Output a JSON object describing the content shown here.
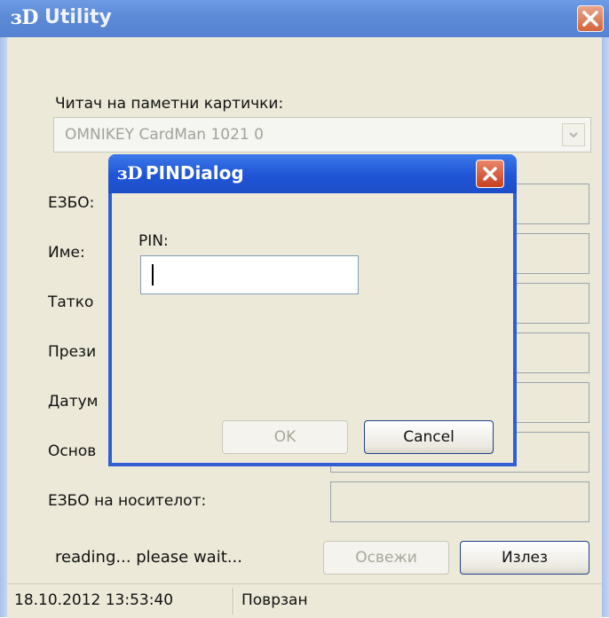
{
  "main_window": {
    "title": "Utility",
    "logo_text": "ɜD",
    "reader_label": "Читач на паметни картички:",
    "reader_value": "OMNIKEY CardMan 1021 0",
    "fields": [
      {
        "label": "ЕЗБО:"
      },
      {
        "label": "Име:"
      },
      {
        "label": "Татко"
      },
      {
        "label": "Прези"
      },
      {
        "label": "Датум"
      },
      {
        "label": "Основ"
      },
      {
        "label": "ЕЗБО на носителот:"
      }
    ],
    "status_message": "reading... please wait...",
    "refresh_button": "Освежи",
    "exit_button": "Излез",
    "statusbar": {
      "datetime": "18.10.2012 13:53:40",
      "connection": "Поврзан"
    }
  },
  "pin_dialog": {
    "title": "PINDialog",
    "logo_text": "ɜD",
    "pin_label": "PIN:",
    "pin_value": "",
    "ok_button": "OK",
    "cancel_button": "Cancel"
  },
  "colors": {
    "titlebar_inactive": "#6f9be4",
    "titlebar_active": "#1f55d6",
    "close_button": "#c74021",
    "client_bg": "#ece9d8"
  }
}
